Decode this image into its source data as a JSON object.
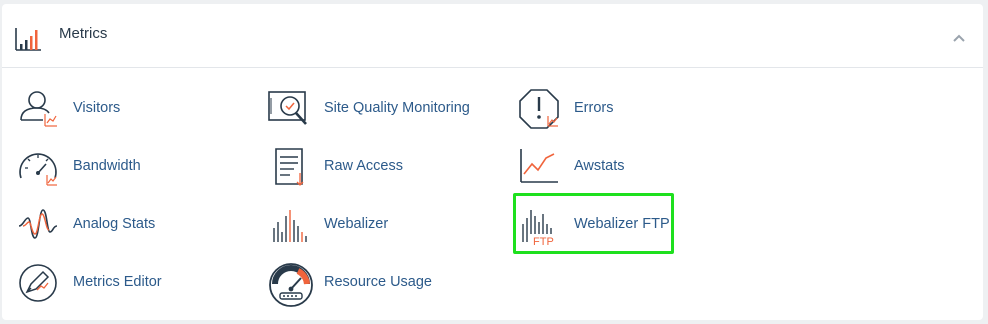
{
  "panel": {
    "title": "Metrics",
    "header_icon": "bar-chart-icon",
    "collapse_icon": "chevron-up-icon"
  },
  "items": [
    {
      "label": "Visitors",
      "icon": "visitors-icon"
    },
    {
      "label": "Site Quality Monitoring",
      "icon": "site-quality-icon"
    },
    {
      "label": "Errors",
      "icon": "errors-icon"
    },
    {
      "label": "Bandwidth",
      "icon": "bandwidth-icon"
    },
    {
      "label": "Raw Access",
      "icon": "raw-access-icon"
    },
    {
      "label": "Awstats",
      "icon": "awstats-icon"
    },
    {
      "label": "Analog Stats",
      "icon": "analog-stats-icon"
    },
    {
      "label": "Webalizer",
      "icon": "webalizer-icon"
    },
    {
      "label": "Webalizer FTP",
      "icon": "webalizer-ftp-icon",
      "icon_text": "FTP"
    },
    {
      "label": "Metrics Editor",
      "icon": "metrics-editor-icon"
    },
    {
      "label": "Resource Usage",
      "icon": "resource-usage-icon"
    }
  ],
  "colors": {
    "accent": "#f0643c",
    "link": "#2c5a8a",
    "icon_stroke": "#293a4a",
    "highlight": "#1ee01e"
  }
}
